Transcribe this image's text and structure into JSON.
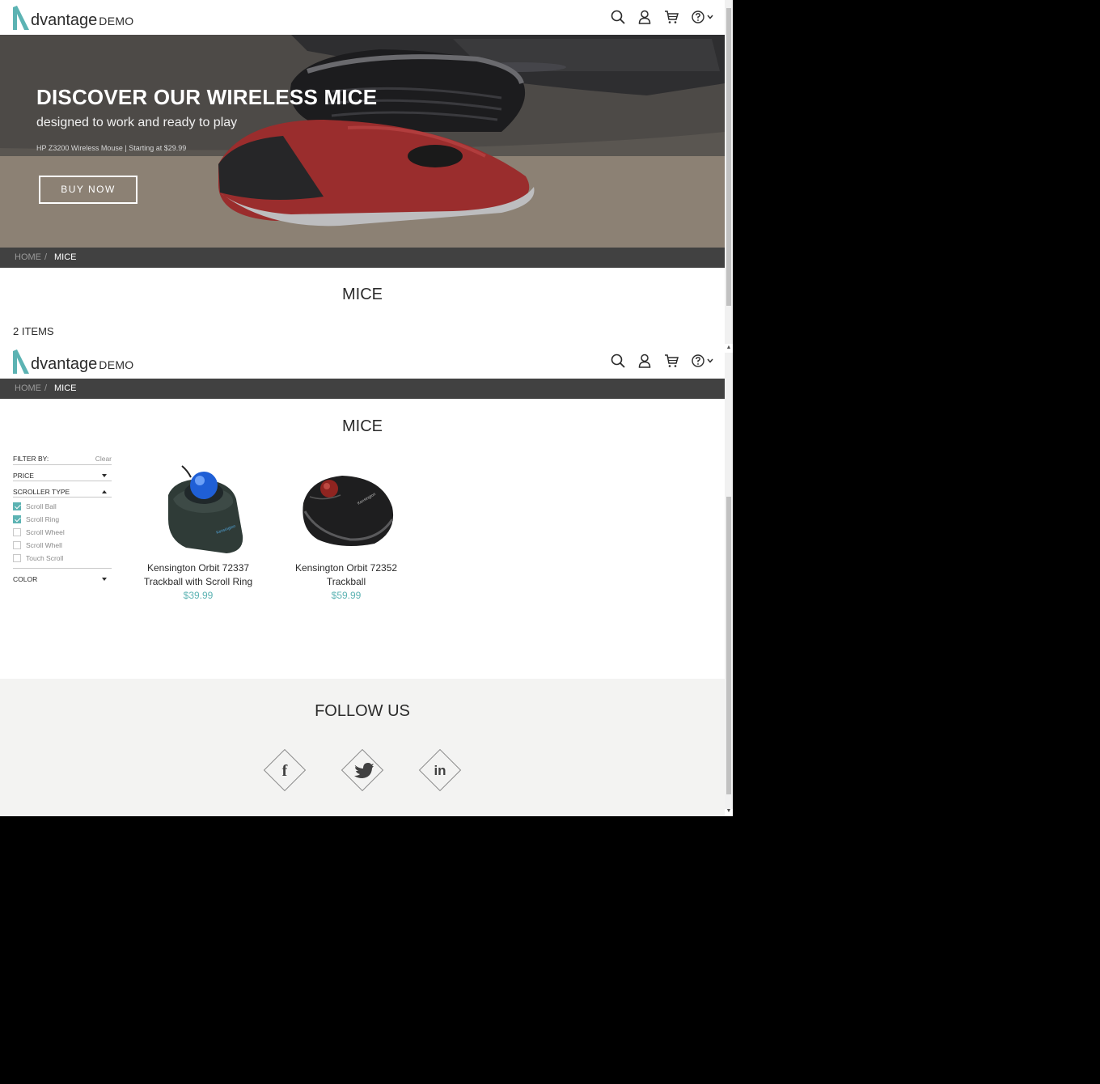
{
  "logo": {
    "word": "dvantage",
    "demo": "DEMO"
  },
  "hero": {
    "title": "DISCOVER OUR WIRELESS MICE",
    "subtitle": "designed to work and ready to play",
    "small": "HP Z3200 Wireless Mouse | Starting at $29.99",
    "button": "BUY NOW"
  },
  "breadcrumb": {
    "home": "HOME",
    "separator": "/",
    "current": "MICE"
  },
  "page_title": "MICE",
  "items_count": "2 ITEMS",
  "filter": {
    "header": "FILTER BY:",
    "clear": "Clear",
    "sections": {
      "price": "PRICE",
      "scroller_type": "SCROLLER TYPE",
      "color": "COLOR"
    },
    "options": [
      {
        "label": "Scroll Ball",
        "checked": true
      },
      {
        "label": "Scroll Ring",
        "checked": true
      },
      {
        "label": "Scroll Wheel",
        "checked": false
      },
      {
        "label": "Scroll Whell",
        "checked": false
      },
      {
        "label": "Touch Scroll",
        "checked": false
      }
    ]
  },
  "products": [
    {
      "name": "Kensington Orbit 72337 Trackball with Scroll Ring",
      "price": "$39.99"
    },
    {
      "name": "Kensington Orbit 72352 Trackball",
      "price": "$59.99"
    }
  ],
  "footer": {
    "follow": "FOLLOW US",
    "social": [
      "facebook",
      "twitter",
      "linkedin"
    ]
  },
  "icons": [
    "search-icon",
    "user-icon",
    "cart-icon",
    "help-icon",
    "chevron-down-icon"
  ],
  "colors": {
    "accent": "#5cb3b3",
    "crumb_bg": "#414141",
    "footer_bg": "#f3f3f2"
  }
}
